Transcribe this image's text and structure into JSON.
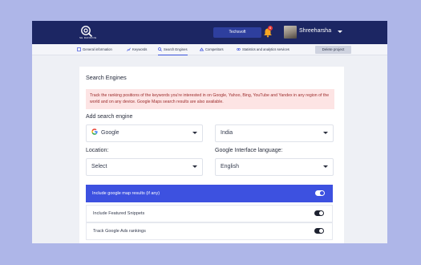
{
  "header": {
    "logo_text": "SE RANKING",
    "company_button": "Techsvoft",
    "notification_count": "6",
    "username": "Shreeharsha"
  },
  "tabs": [
    {
      "label": "General information",
      "icon": "info-icon"
    },
    {
      "label": "Keywords",
      "icon": "chart-icon"
    },
    {
      "label": "Search Engines",
      "icon": "search-icon"
    },
    {
      "label": "Competitors",
      "icon": "competitors-icon"
    },
    {
      "label": "Statistics and analytics services",
      "icon": "link-icon"
    }
  ],
  "delete_button": "Delete project",
  "card": {
    "title": "Search Engines",
    "alert": "Track the ranking positions of the keywords you're interested in on Google, Yahoo, Bing, YouTube and Yandex in any region of the world and on any device. Google Maps search results are also available.",
    "add_label": "Add search engine",
    "engine_value": "Google",
    "country_value": "India",
    "location_label": "Location:",
    "location_value": "Select",
    "language_label": "Google Interface language:",
    "language_value": "English"
  },
  "options": [
    {
      "label": "Include google map results (if any)",
      "on": true
    },
    {
      "label": "Include Featured Snippets",
      "on": false
    },
    {
      "label": "Track Google Ads rankings",
      "on": false
    }
  ],
  "colors": {
    "topbar": "#1c2663",
    "accent": "#3d51e0",
    "alert_bg": "#fde4e4",
    "page_bg": "#aeb6e8"
  }
}
